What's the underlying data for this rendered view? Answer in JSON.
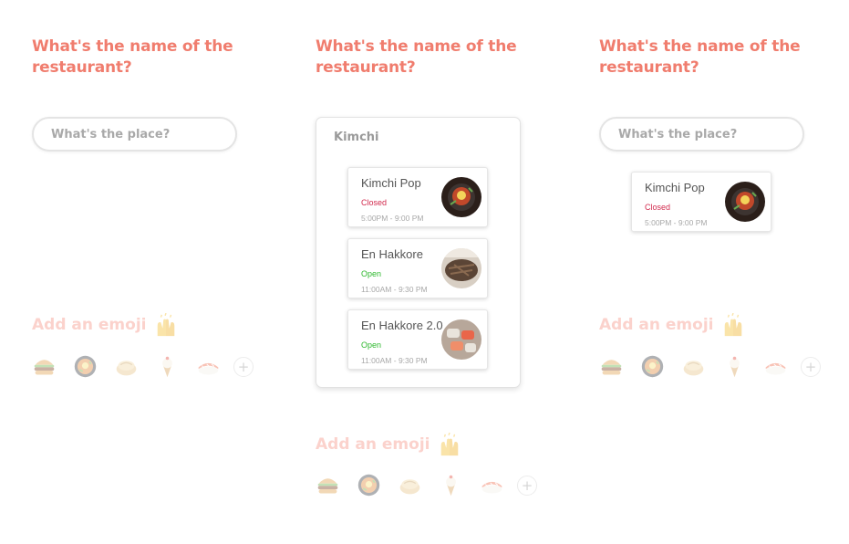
{
  "panels": [
    {
      "question": "What's the name of the restaurant?",
      "search_placeholder": "What's the place?",
      "emoji_heading": "Add an emoji"
    },
    {
      "question": "What's the name of the restaurant?",
      "search_query": "Kimchi",
      "results": [
        {
          "name": "Kimchi Pop",
          "status": "Closed",
          "hours": "5:00PM - 9:00 PM"
        },
        {
          "name": "En Hakkore",
          "status": "Open",
          "hours": "11:00AM - 9:30 PM"
        },
        {
          "name": "En Hakkore 2.0",
          "status": "Open",
          "hours": "11:00AM - 9:30 PM"
        }
      ],
      "emoji_heading": "Add an emoji"
    },
    {
      "question": "What's the name of the restaurant?",
      "search_placeholder": "What's the place?",
      "selected": {
        "name": "Kimchi Pop",
        "status": "Closed",
        "hours": "5:00PM - 9:00 PM"
      },
      "emoji_heading": "Add an emoji"
    }
  ],
  "emoji_options": [
    "hamburger-icon",
    "bibimbap-bowl-icon",
    "dumpling-icon",
    "ice-cream-cone-icon",
    "sushi-icon"
  ],
  "add_button": "+",
  "colors": {
    "title": "#f07d6e",
    "faded_heading": "#fbd2cc",
    "closed": "#d22b4e",
    "open": "#2eb82e"
  }
}
